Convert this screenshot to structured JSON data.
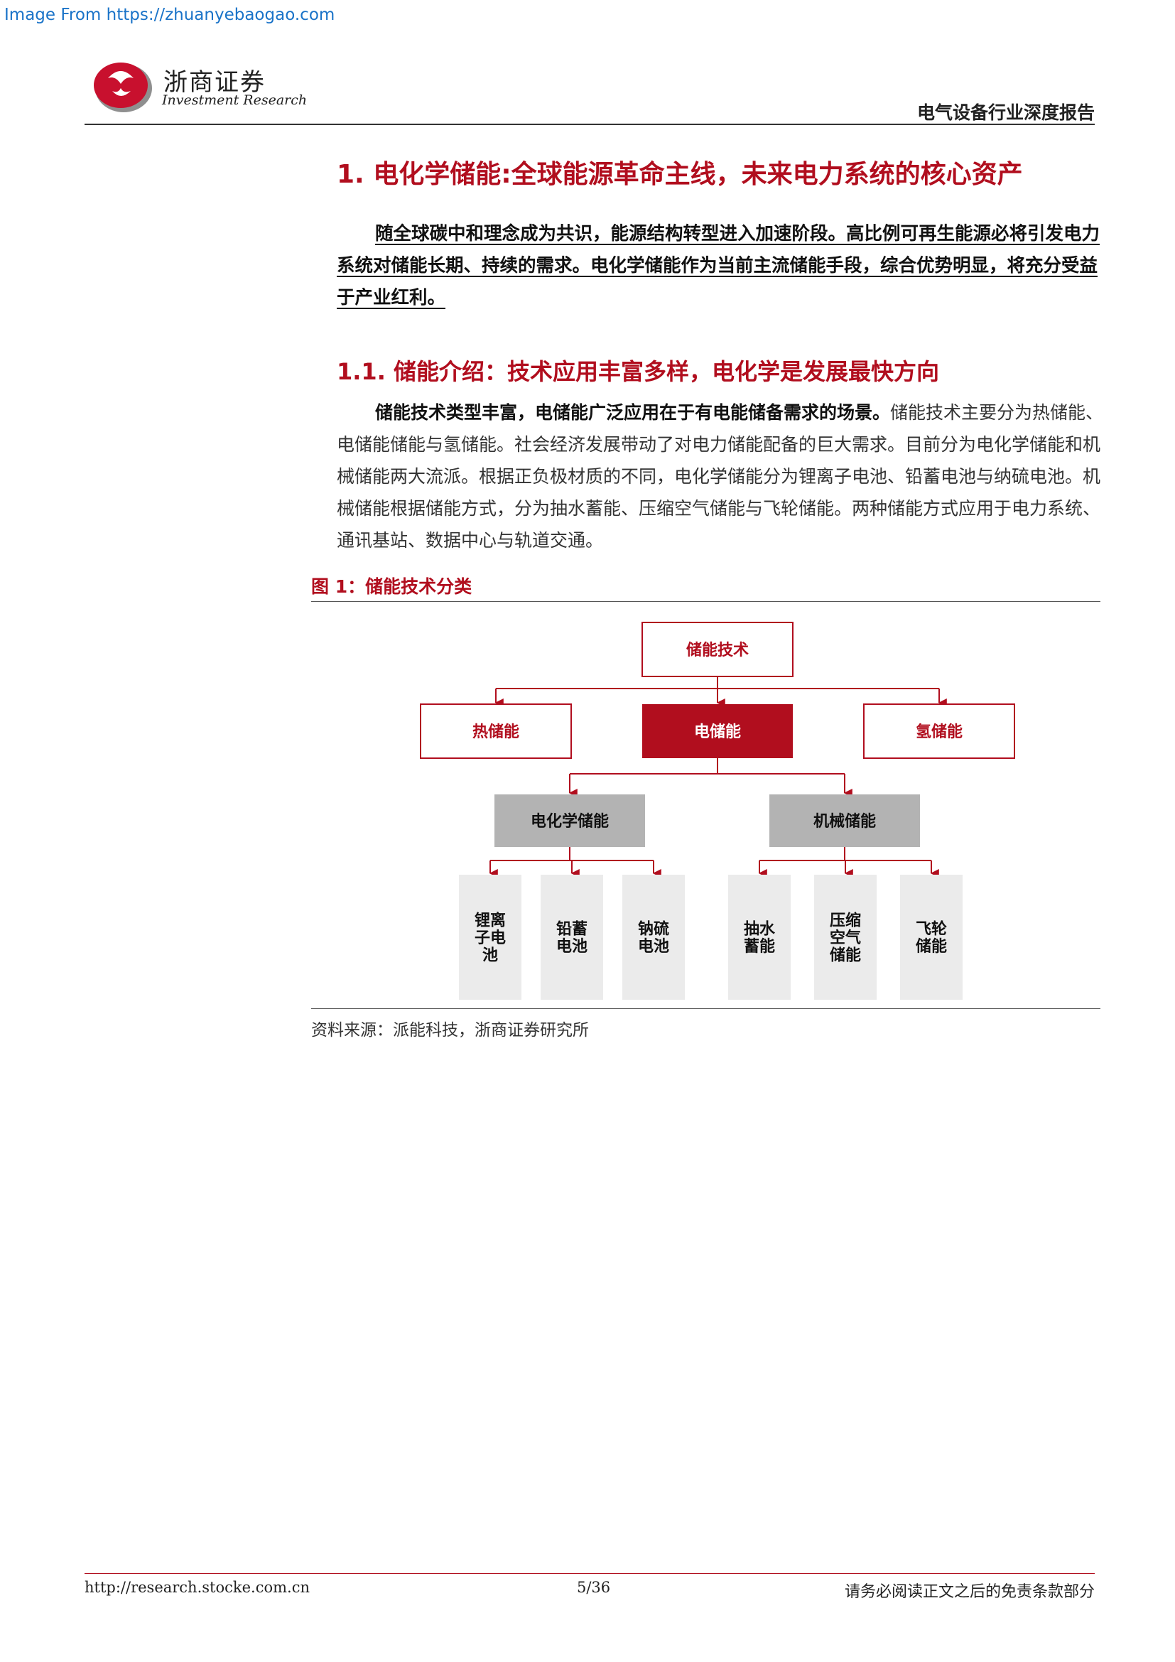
{
  "watermark": "Image From https://zhuanyebaogao.com",
  "header": {
    "logo_cn": "浙商证券",
    "logo_en": "Investment Research",
    "report_type": "电气设备行业深度报告"
  },
  "section1": {
    "title": "1. 电化学储能:全球能源革命主线，未来电力系统的核心资产",
    "intro": "随全球碳中和理念成为共识，能源结构转型进入加速阶段。高比例可再生能源必将引发电力系统对储能长期、持续的需求。电化学储能作为当前主流储能手段，综合优势明显，将充分受益于产业红利。"
  },
  "section1_1": {
    "title": "1.1. 储能介绍：技术应用丰富多样，电化学是发展最快方向",
    "lead": "储能技术类型丰富，电储能广泛应用在于有电能储备需求的场景。",
    "body": "储能技术主要分为热储能、电储能储能与氢储能。社会经济发展带动了对电力储能配备的巨大需求。目前分为电化学储能和机械储能两大流派。根据正负极材质的不同，电化学储能分为锂离子电池、铅蓄电池与纳硫电池。机械储能根据储能方式，分为抽水蓄能、压缩空气储能与飞轮储能。两种储能方式应用于电力系统、通讯基站、数据中心与轨道交通。"
  },
  "figure": {
    "title": "图 1：储能技术分类",
    "source": "资料来源：派能科技，浙商证券研究所",
    "root": "储能技术",
    "level2": [
      "热储能",
      "电储能",
      "氢储能"
    ],
    "level3": [
      "电化学储能",
      "机械储能"
    ],
    "leaves_electrochemical": [
      [
        "锂离",
        "子电",
        "池"
      ],
      [
        "铅蓄",
        "电池"
      ],
      [
        "钠硫",
        "电池"
      ]
    ],
    "leaves_mechanical": [
      [
        "抽水",
        "蓄能"
      ],
      [
        "压缩",
        "空气",
        "储能"
      ],
      [
        "飞轮",
        "储能"
      ]
    ],
    "colors": {
      "accent": "#b10e1e",
      "gray_box": "#b3b3b3",
      "light_box": "#ebebeb"
    }
  },
  "footer": {
    "url": "http://research.stocke.com.cn",
    "page": "5/36",
    "disclaimer": "请务必阅读正文之后的免责条款部分"
  }
}
